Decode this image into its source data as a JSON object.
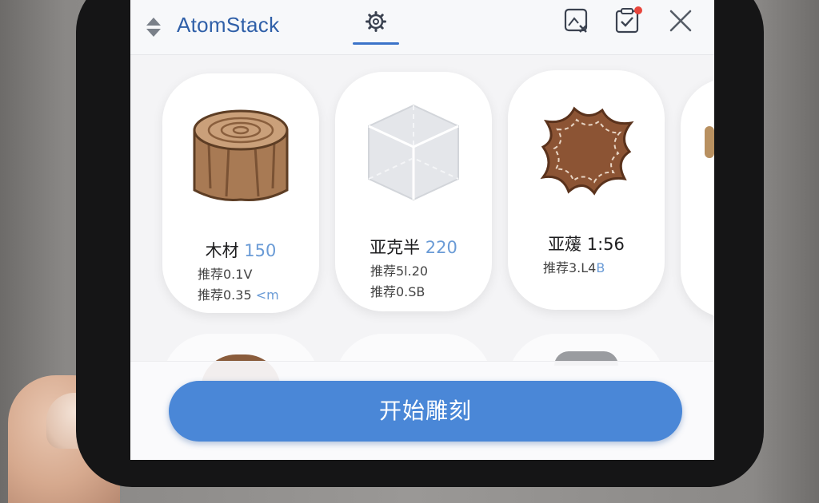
{
  "header": {
    "app_title": "AtomStack",
    "sort_icon": "sort-arrows-icon",
    "active_tab_icon": "gear-icon",
    "right_icons": [
      "image-cancel-icon",
      "checklist-icon",
      "close-icon"
    ],
    "notification_dot_color": "#e8453c"
  },
  "materials": [
    {
      "name": "木材",
      "size": "150",
      "line1_prefix": "推荐0.1V",
      "line1_suffix": "",
      "line2_prefix": "推荐0.35",
      "line2_suffix": "<m",
      "icon": "wood-log-icon"
    },
    {
      "name": "亚克半",
      "size": "220",
      "line1_prefix": "推荐5l.20",
      "line1_suffix": "",
      "line2_prefix": "推荐0.SB",
      "line2_suffix": "",
      "icon": "acrylic-cube-icon"
    },
    {
      "name": "亚蕿",
      "size": "1:56",
      "line1_prefix": "推荐3.L4",
      "line1_suffix": "B",
      "line2_prefix": "",
      "line2_suffix": "",
      "icon": "leather-hide-icon"
    }
  ],
  "action": {
    "start_label": "开始雕刻"
  },
  "colors": {
    "accent": "#4a87d7",
    "title": "#2f5fa8"
  }
}
